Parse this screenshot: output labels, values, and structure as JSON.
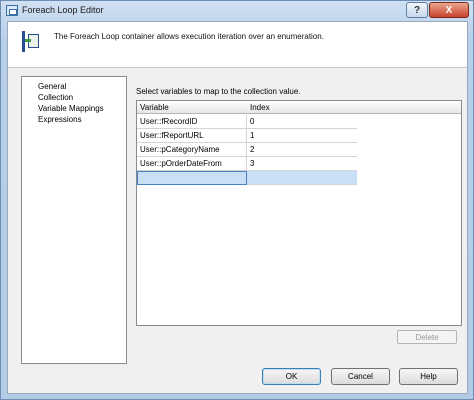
{
  "window": {
    "title": "Foreach Loop Editor",
    "help_glyph": "?",
    "close_glyph": "X"
  },
  "header": {
    "description": "The Foreach Loop container allows execution iteration over an enumeration."
  },
  "nav": {
    "items": [
      "General",
      "Collection",
      "Variable Mappings",
      "Expressions"
    ]
  },
  "mapping": {
    "label": "Select variables to map to the collection value.",
    "columns": {
      "variable": "Variable",
      "index": "Index"
    },
    "rows": [
      {
        "variable": "User::fRecordID",
        "index": "0"
      },
      {
        "variable": "User::fReportURL",
        "index": "1"
      },
      {
        "variable": "User::pCategoryName",
        "index": "2"
      },
      {
        "variable": "User::pOrderDateFrom",
        "index": "3"
      }
    ]
  },
  "buttons": {
    "delete": "Delete",
    "ok": "OK",
    "cancel": "Cancel",
    "help": "Help"
  },
  "colors": {
    "selection": "#c9dff5",
    "title_gradient": "#b8cfe9"
  }
}
